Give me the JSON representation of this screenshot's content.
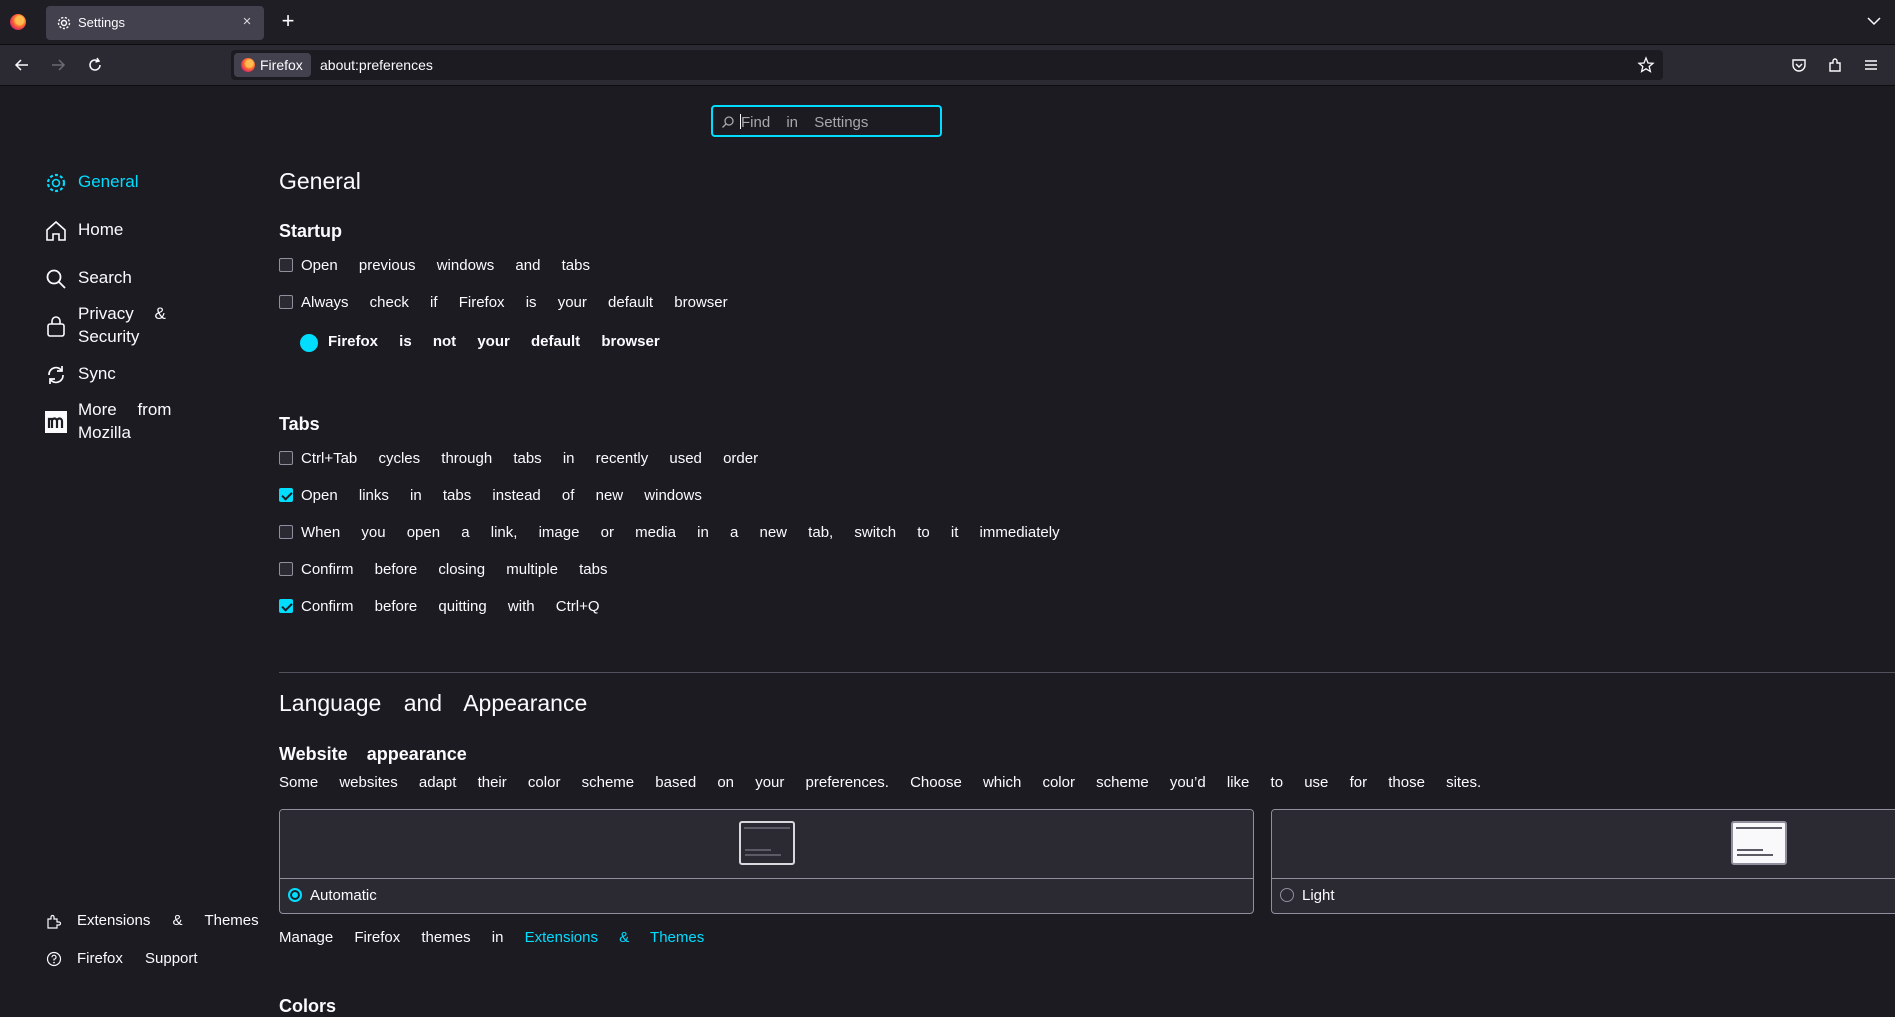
{
  "tab": {
    "title": "Settings",
    "close": "×",
    "new_tab": "+"
  },
  "urlbar": {
    "identity_label": "Firefox",
    "url": "about:preferences"
  },
  "search": {
    "placeholder": "Find in Settings"
  },
  "sidebar": {
    "items": [
      {
        "label": "General",
        "icon": "gear-icon",
        "selected": true
      },
      {
        "label": "Home",
        "icon": "home-icon"
      },
      {
        "label": "Search",
        "icon": "search-icon"
      },
      {
        "label": "Privacy & Security",
        "icon": "lock-icon"
      },
      {
        "label": "Sync",
        "icon": "sync-icon"
      },
      {
        "label": "More from Mozilla",
        "icon": "mozilla-icon"
      }
    ],
    "footer": [
      {
        "label": "Extensions & Themes",
        "icon": "puzzle-icon"
      },
      {
        "label": "Firefox Support",
        "icon": "help-icon"
      }
    ]
  },
  "general": {
    "title": "General",
    "startup": {
      "title": "Startup",
      "open_previous": {
        "label": "Open previous windows and tabs",
        "checked": false
      },
      "always_check": {
        "label": "Always check if Firefox is your default browser",
        "checked": false
      },
      "not_default": "Firefox is not your default browser"
    },
    "tabs": {
      "title": "Tabs",
      "options": [
        {
          "label": "Ctrl+Tab cycles through tabs in recently used order",
          "checked": false
        },
        {
          "label": "Open links in tabs instead of new windows",
          "checked": true
        },
        {
          "label": "When you open a link, image or media in a new tab, switch to it immediately",
          "checked": false
        },
        {
          "label": "Confirm before closing multiple tabs",
          "checked": false
        },
        {
          "label": "Confirm before quitting with Ctrl+Q",
          "checked": true
        }
      ]
    }
  },
  "language": {
    "title": "Language and Appearance",
    "website_appearance": {
      "title": "Website appearance",
      "description": "Some websites adapt their color scheme based on your preferences. Choose which color scheme you’d like to use for those sites.",
      "options": [
        {
          "label": "Automatic",
          "selected": true
        },
        {
          "label": "Light",
          "selected": false
        }
      ],
      "manage_prefix": "Manage Firefox themes in",
      "manage_link": "Extensions & Themes"
    },
    "colors_title": "Colors"
  },
  "colors": {
    "accent": "#00ddff",
    "background": "#1c1b22"
  }
}
